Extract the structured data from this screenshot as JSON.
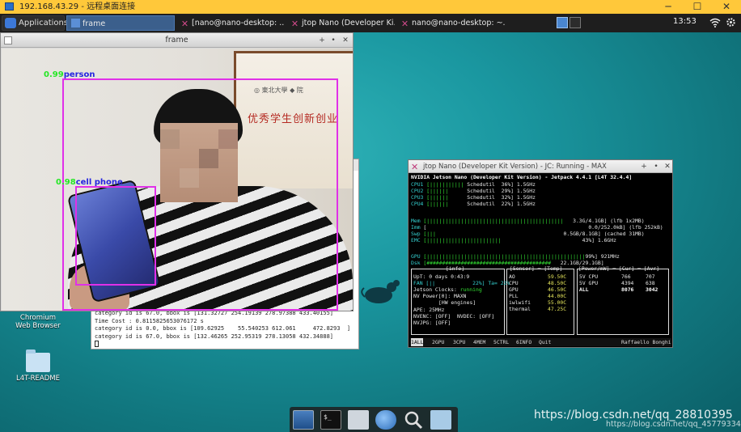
{
  "remote": {
    "title": "192.168.43.29 - 远程桌面连接",
    "minimize": "─",
    "maximize": "☐",
    "close": "✕"
  },
  "panel": {
    "applications": "Applications",
    "tasks": [
      {
        "label": "frame",
        "active": true
      },
      {
        "label": "[nano@nano-desktop: ..."
      },
      {
        "label": "jtop Nano (Developer Ki..."
      },
      {
        "label": "nano@nano-desktop: ~..."
      }
    ],
    "clock": "13:53"
  },
  "frame_window": {
    "title": "frame",
    "detections": [
      {
        "confidence": "0.99",
        "label": "person"
      },
      {
        "confidence": "0.98",
        "label": "cell phone"
      }
    ],
    "cert_text": "优秀学生创新创业"
  },
  "terminal": {
    "lines": [
      "category id is 67.0, bbox is [131.32727 254.19139 278.97388 433.40155]",
      "Time Cost : 0.8115825653076172 s",
      "category id is 0.0, bbox is [109.62925    55.540253 612.061     472.8293  ]",
      "category id is 67.0, bbox is [132.46265 252.95319 278.13058 432.34888]"
    ]
  },
  "jtop": {
    "title": "jtop Nano (Developer Kit Version) - JC: Running - MAX",
    "header": "NVIDIA Jetson Nano (Developer Kit Version) - Jetpack 4.4.1 [L4T 32.4.4]",
    "cpus": [
      {
        "name": "CPU1",
        "bar": "[|||||||||||",
        "gov": "Schedutil",
        "pct": "36%]",
        "freq": "1.5GHz"
      },
      {
        "name": "CPU2",
        "bar": "[||||||",
        "gov": "Schedutil",
        "pct": "29%]",
        "freq": "1.5GHz"
      },
      {
        "name": "CPU3",
        "bar": "[||||||",
        "gov": "Schedutil",
        "pct": "32%]",
        "freq": "1.5GHz"
      },
      {
        "name": "CPU4",
        "bar": "[||||||",
        "gov": "Schedutil",
        "pct": "22%]",
        "freq": "1.5GHz"
      }
    ],
    "mem": {
      "name": "Mem",
      "value": "3.3G/4.1GB] (lfb 1x2MB)"
    },
    "imm": {
      "name": "Imm",
      "value": "0.0/252.0kB] (lfb 252kB)"
    },
    "swp": {
      "name": "Swp",
      "value": "0.5GB/8.1GB] (cached 31MB)"
    },
    "emc": {
      "name": "EMC",
      "value": "43%] 1.6GHz"
    },
    "gpu": {
      "name": "GPU",
      "value": "99%] 921MHz"
    },
    "dsk": {
      "name": "Dsk",
      "value": "22.1GB/29.1GB]"
    },
    "info": {
      "title": "[info]",
      "uptime": "UpT: 0 days 0:43:9",
      "fan": "FAN [||            22%] Ta= 22%",
      "clocks_label": "Jetson Clocks:",
      "clocks_value": "running",
      "power": "NV Power[0]: MAXN",
      "hw_title": "[HW engines]",
      "ape": "APE: 25MHz",
      "nvenc": "NVENC: [OFF]",
      "nvdec": "NVDEC: [OFF]",
      "nvjpg": "NVJPG: [OFF]"
    },
    "sensors": {
      "title": "[Sensor] ─ [Temp]",
      "rows": [
        {
          "name": "AO",
          "temp": "59.50C"
        },
        {
          "name": "CPU",
          "temp": "48.50C"
        },
        {
          "name": "GPU",
          "temp": "46.50C"
        },
        {
          "name": "PLL",
          "temp": "44.00C"
        },
        {
          "name": "iwlwifi",
          "temp": "55.00C"
        },
        {
          "name": "thermal",
          "temp": "47.25C"
        }
      ]
    },
    "power": {
      "title": "[Power/mW] ─ [Cur] ─ [Avr]",
      "rows": [
        {
          "name": "5V CPU",
          "cur": "766",
          "avr": "707"
        },
        {
          "name": "5V GPU",
          "cur": "4394",
          "avr": "638"
        },
        {
          "name": "ALL",
          "cur": "8076",
          "avr": "3042"
        }
      ]
    },
    "footer": [
      "1ALL",
      "2GPU",
      "3CPU",
      "4MEM",
      "5CTRL",
      "6INFO",
      "Quit"
    ],
    "author": "Raffaello Bonghi"
  },
  "desktop": {
    "chromium": [
      "Chromium",
      "Web Browser"
    ],
    "folder": "L4T-README"
  },
  "watermark": {
    "main": "https://blog.csdn.net/qq_28810395",
    "sub": "https://blog.csdn.net/qq_45779334"
  }
}
